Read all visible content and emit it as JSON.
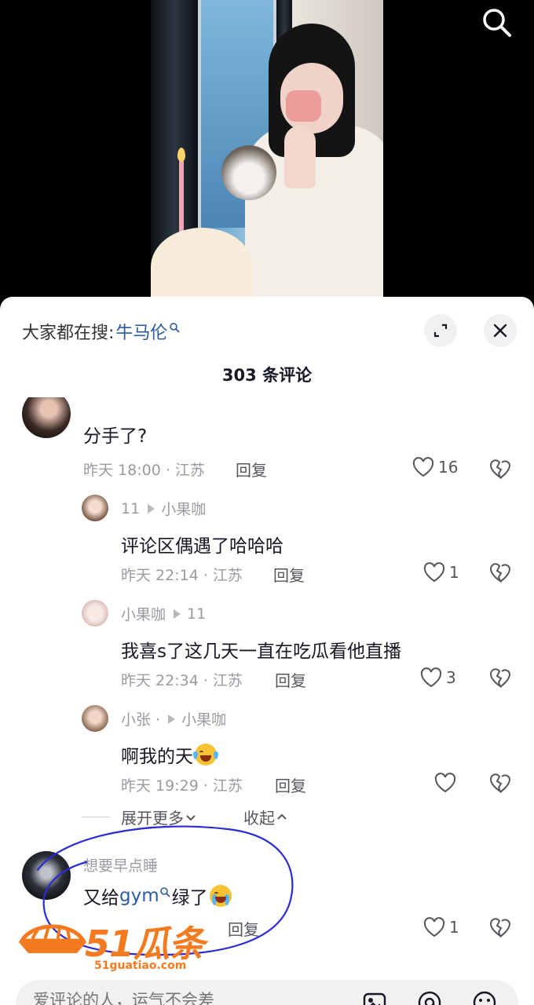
{
  "hot_search": {
    "label": "大家都在搜:",
    "term": "牛马伦"
  },
  "comment_count": "303 条评论",
  "comments": [
    {
      "name": "",
      "text": "分手了?",
      "time": "昨天 18:00 · 江苏",
      "reply": "回复",
      "likes": "16"
    },
    {
      "name": "11",
      "reply_to": "小果咖",
      "text": "评论区偶遇了哈哈哈",
      "time": "昨天 22:14 · 江苏",
      "reply": "回复",
      "likes": "1"
    },
    {
      "name": "小果咖",
      "reply_to": "11",
      "text": "我喜s了这几天一直在吃瓜看他直播",
      "time": "昨天 22:34 · 江苏",
      "reply": "回复",
      "likes": "3"
    },
    {
      "name": "小张 ·",
      "reply_to": "小果咖",
      "text": "啊我的天",
      "time": "昨天 19:29 · 江苏",
      "reply": "回复",
      "likes": ""
    },
    {
      "name": "想要早点睡",
      "text_before": "又给",
      "text_link": "gym",
      "text_after": "绿了",
      "reply": "回复",
      "likes": "1"
    }
  ],
  "expand_more": "展开更多",
  "collapse": "收起",
  "watermark": {
    "brand": "51瓜条",
    "url": "51guatiao.com"
  },
  "input": {
    "placeholder": "爱评论的人，运气不会差"
  },
  "icons": {
    "search": "search-icon",
    "expand": "expand-icon",
    "close": "close-icon",
    "like": "heart-icon",
    "dislike": "broken-heart-icon",
    "image": "image-icon",
    "mention": "at-icon",
    "emoji": "emoji-icon"
  },
  "colors": {
    "accent_link": "#2c5aa0",
    "watermark": "#f47a1f",
    "annotation": "#2b2bd6"
  }
}
